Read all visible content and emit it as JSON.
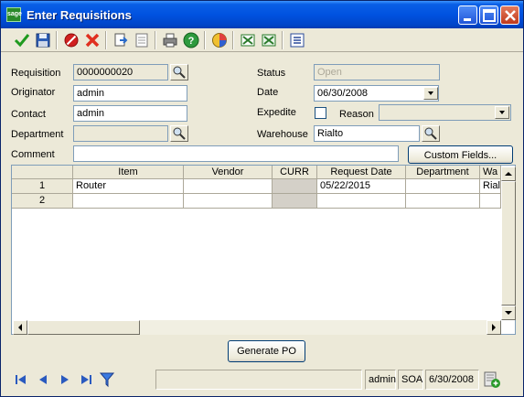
{
  "window": {
    "title": "Enter Requisitions",
    "logo_text": "sage"
  },
  "toolbar": {
    "icons": [
      "accept-icon",
      "save-icon",
      "delete-icon",
      "cancel-icon",
      "copy-icon",
      "notes-icon",
      "print-icon",
      "help-icon",
      "color-icon",
      "export-icon",
      "import-icon",
      "settings-icon"
    ]
  },
  "form": {
    "requisition": {
      "label": "Requisition",
      "value": "0000000020"
    },
    "originator": {
      "label": "Originator",
      "value": "admin"
    },
    "contact": {
      "label": "Contact",
      "value": "admin"
    },
    "department": {
      "label": "Department",
      "value": ""
    },
    "comment": {
      "label": "Comment",
      "value": ""
    },
    "status": {
      "label": "Status",
      "value": "Open"
    },
    "date": {
      "label": "Date",
      "value": "06/30/2008"
    },
    "expedite": {
      "label": "Expedite",
      "checked": false
    },
    "reason": {
      "label": "Reason",
      "value": ""
    },
    "warehouse": {
      "label": "Warehouse",
      "value": "Rialto"
    },
    "custom_fields_label": "Custom Fields..."
  },
  "grid": {
    "columns": [
      "Item",
      "Vendor",
      "CURR",
      "Request Date",
      "Department",
      "Wa"
    ],
    "rows": [
      {
        "num": "1",
        "item": "Router",
        "vendor": "",
        "curr": "",
        "request_date": "05/22/2015",
        "department": "",
        "warehouse": "Rialt"
      },
      {
        "num": "2",
        "item": "",
        "vendor": "",
        "curr": "",
        "request_date": "",
        "department": "",
        "warehouse": ""
      }
    ]
  },
  "generate_po_label": "Generate PO",
  "statusbar": {
    "message": "",
    "user": "admin",
    "company": "SOA",
    "date": "6/30/2008"
  },
  "colors": {
    "title_bar": "#0052e0",
    "window_bg": "#ece9d8",
    "accent_green": "#2a8a2a"
  }
}
